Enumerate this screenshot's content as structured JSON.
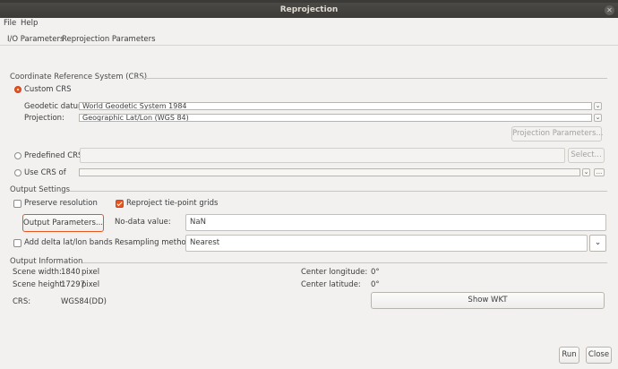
{
  "window": {
    "title": "Reprojection"
  },
  "menu": {
    "file": "File",
    "help": "Help"
  },
  "tabs": [
    {
      "label": "I/O Parameters"
    },
    {
      "label": "Reprojection Parameters"
    }
  ],
  "crs": {
    "group_title": "Coordinate Reference System (CRS)",
    "custom_label": "Custom CRS",
    "datum_label": "Geodetic datum:",
    "datum_value": "World Geodetic System 1984",
    "projection_label": "Projection:",
    "projection_value": "Geographic Lat/Lon (WGS 84)",
    "projection_params_button": "Projection Parameters...",
    "predefined_label": "Predefined CRS",
    "predefined_value": "",
    "select_button": "Select...",
    "use_crs_label": "Use CRS of",
    "use_crs_value": "",
    "use_crs_more": "..."
  },
  "output_settings": {
    "group_title": "Output Settings",
    "preserve_resolution_label": "Preserve resolution",
    "preserve_resolution_checked": false,
    "reproject_tie_label": "Reproject tie-point grids",
    "reproject_tie_checked": true,
    "output_params_button": "Output Parameters...",
    "nodata_label": "No-data value:",
    "nodata_value": "NaN",
    "add_delta_label": "Add delta lat/lon bands",
    "add_delta_checked": false,
    "resampling_label": "Resampling method:",
    "resampling_value": "Nearest"
  },
  "output_info": {
    "group_title": "Output Information",
    "scene_width_label": "Scene width:",
    "scene_width_value": "1840",
    "scene_width_unit": "pixel",
    "scene_height_label": "Scene height:",
    "scene_height_value": "17297",
    "scene_height_unit": "pixel",
    "crs_label": "CRS:",
    "crs_value": "WGS84(DD)",
    "center_lon_label": "Center longitude:",
    "center_lon_value": "0°",
    "center_lat_label": "Center latitude:",
    "center_lat_value": "0°",
    "show_wkt_button": "Show WKT"
  },
  "footer": {
    "run_button": "Run",
    "close_button": "Close"
  },
  "colors": {
    "accent": "#e95420",
    "titlebar": "#3c3b37",
    "window_bg": "#f2f1f0"
  }
}
